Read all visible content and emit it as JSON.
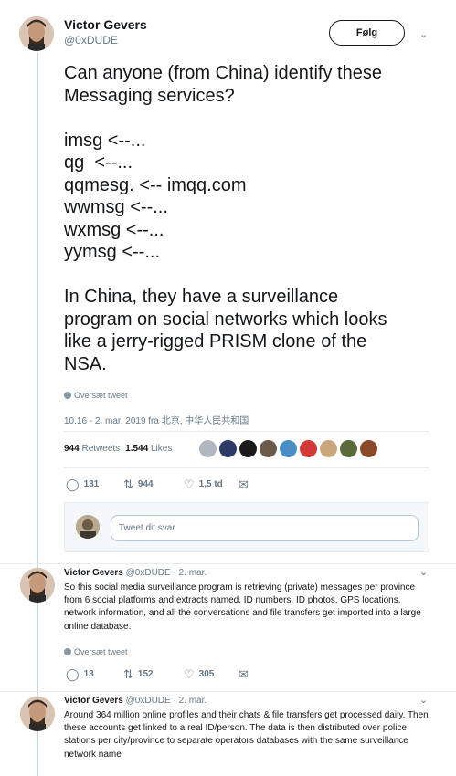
{
  "main_tweet": {
    "name": "Victor Gevers",
    "handle": "@0xDUDE",
    "follow_label": "Følg",
    "text": "Can anyone (from China) identify these\nMessaging services?\n\nimsg <--...\nqg  <--...\nqqmesg. <-- imqq.com\nwwmsg <--...\nwxmsg <--...\nyymsg <--...\n\nIn China, they have a surveillance\nprogram on social networks which looks\nlike a jerry-rigged PRISM clone of the\nNSA.",
    "translate_label": "Oversæt tweet",
    "timestamp": "10.16 - 2. mar. 2019 fra 北京, 中华人民共和国",
    "retweets_count": "944",
    "retweets_label": "Retweets",
    "likes_count": "1.544",
    "likes_label": "Likes",
    "actions": {
      "replies": "131",
      "retweets": "944",
      "likes": "1,5 td"
    }
  },
  "reply_box": {
    "placeholder": "Tweet dit svar"
  },
  "replies": [
    {
      "name": "Victor Gevers",
      "meta": "@0xDUDE · 2. mar.",
      "text": "So this social media surveillance program is retrieving (private) messages per province from 6 social platforms and extracts named, ID numbers, ID photos, GPS locations, network information, and all the conversations and file transfers get imported into a large online database.",
      "translate_label": "Oversæt tweet",
      "actions": {
        "replies": "13",
        "retweets": "152",
        "likes": "305"
      }
    },
    {
      "name": "Victor Gevers",
      "meta": "@0xDUDE · 2. mar.",
      "text": "Around 364 million online profiles and their chats & file transfers get processed daily. Then these accounts get linked to a real ID/person. The data is then distributed over police stations per city/province to separate operators databases with the same surveillance network name"
    }
  ],
  "icons": {
    "reply": "reply-icon",
    "retweet": "retweet-icon",
    "like": "heart-icon",
    "dm": "envelope-icon",
    "menu": "chevron-down-icon"
  },
  "colors": {
    "text": "#14171a",
    "muted": "#657786",
    "border": "#e6ecf0"
  }
}
